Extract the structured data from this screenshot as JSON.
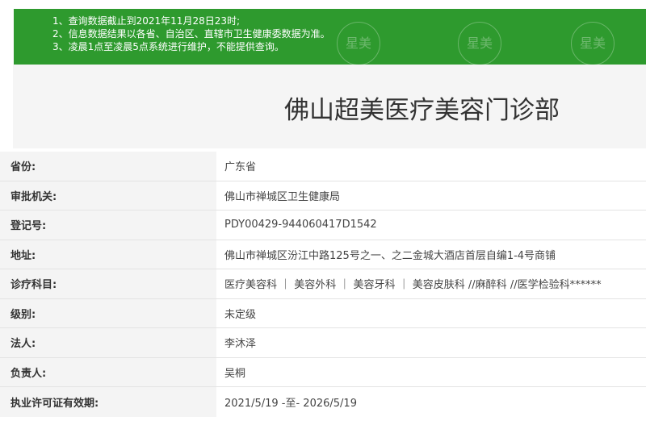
{
  "notice": {
    "lines": [
      "1、查询数据截止到2021年11月28日23时;",
      "2、信息数据结果以各省、自治区、直辖市卫生健康委数据为准。",
      "3、凌晨1点至凌晨5点系统进行维护，不能提供查询。"
    ],
    "watermark": "星美",
    "background_color": "#2e9a2e"
  },
  "org": {
    "title": "佛山超美医疗美容门诊部"
  },
  "details": [
    {
      "label": "省份:",
      "value": "广东省"
    },
    {
      "label": "审批机关:",
      "value": "佛山市禅城区卫生健康局"
    },
    {
      "label": "登记号:",
      "value": "PDY00429-944060417D1542"
    },
    {
      "label": "地址:",
      "value": "佛山市禅城区汾江中路125号之一、之二金城大酒店首层自编1-4号商铺"
    },
    {
      "label": "诊疗科目:",
      "value": "医疗美容科 ｜ 美容外科 ｜ 美容牙科 ｜ 美容皮肤科 //麻醉科 //医学检验科******"
    },
    {
      "label": "级别:",
      "value": "未定级"
    },
    {
      "label": "法人:",
      "value": "李沐泽"
    },
    {
      "label": "负责人:",
      "value": "吴桐"
    },
    {
      "label": "执业许可证有效期:",
      "value": "2021/5/19 -至- 2026/5/19"
    }
  ]
}
